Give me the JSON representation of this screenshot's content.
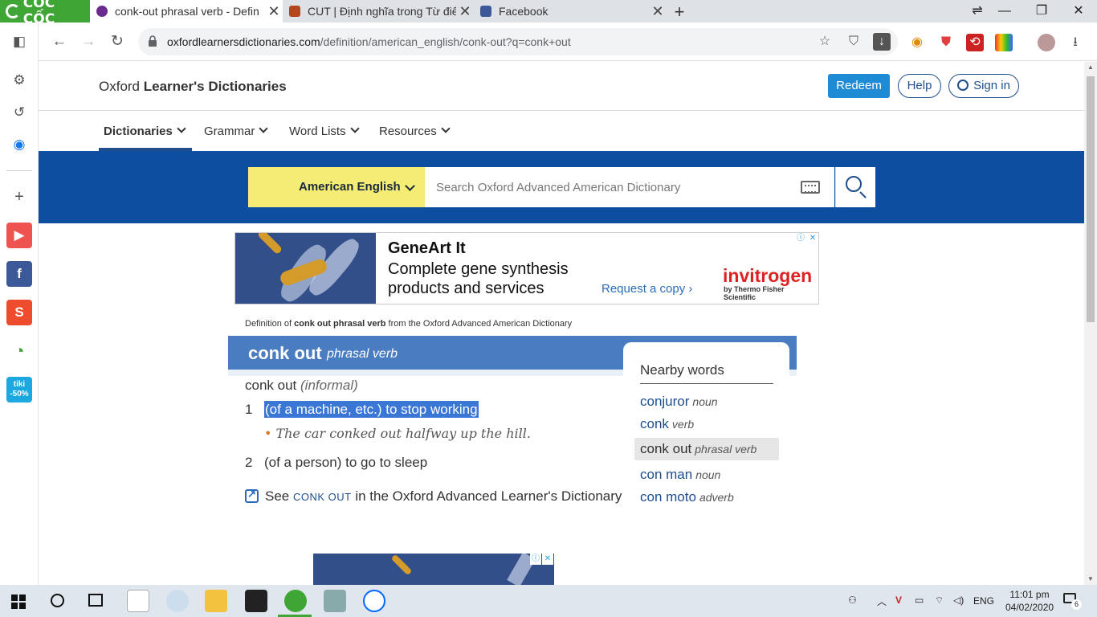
{
  "browser": {
    "brand": "CỐC CỐC",
    "tabs": [
      {
        "title": "conk-out phrasal verb - Defin",
        "active": true,
        "favicon_color": "#6b2c8f"
      },
      {
        "title": "CUT | Định nghĩa trong Từ điể",
        "active": false,
        "favicon_color": "#b5451b"
      },
      {
        "title": "Facebook",
        "active": false,
        "favicon_color": "#3b5998"
      }
    ],
    "url_host": "oxfordlearnersdictionaries.com",
    "url_path": "/definition/american_english/conk-out?q=conk+out"
  },
  "sidebar_icons": [
    "sidebar-toggle-icon",
    "settings-icon",
    "history-icon",
    "messenger-icon",
    "add-icon",
    "youtube-icon",
    "facebook-icon",
    "shopee-icon",
    "coccoc-icon",
    "tiki-icon"
  ],
  "sidebar": {
    "tiki_badge": "-50%"
  },
  "site": {
    "title_prefix": "Oxford ",
    "title_bold": "Learner's Dictionaries",
    "redeem": "Redeem",
    "help": "Help",
    "signin": "Sign in",
    "menu": [
      "Dictionaries",
      "Grammar",
      "Word Lists",
      "Resources"
    ],
    "language": "American English",
    "search_placeholder": "Search Oxford Advanced American Dictionary"
  },
  "ad": {
    "headline": "GeneArt It",
    "body": "Complete gene synthesis products and services",
    "cta": "Request a copy ›",
    "brand": "invitrogen",
    "brand_sub": "by Thermo Fisher Scientific"
  },
  "entry": {
    "source_prefix": "Definition of ",
    "source_bold": "conk out phrasal verb",
    "source_suffix": " from the Oxford Advanced American Dictionary",
    "headword": "conk out",
    "pos": "phrasal verb",
    "phrase": "conk out",
    "register": "(informal)",
    "senses": [
      {
        "num": "1",
        "def": "(of a machine, etc.) to stop working",
        "highlighted": true,
        "example": "The car conked out halfway up the hill."
      },
      {
        "num": "2",
        "def": "(of a person) to go to sleep",
        "highlighted": false
      }
    ],
    "see_prefix": "See ",
    "see_link": "CONK OUT",
    "see_suffix": " in the Oxford Advanced Learner's Dictionary"
  },
  "nearby": {
    "title": "Nearby words",
    "words": [
      {
        "word": "conjuror",
        "pos": "noun"
      },
      {
        "word": "conk",
        "pos": "verb"
      },
      {
        "word": "conk out",
        "pos": "phrasal verb",
        "current": true
      },
      {
        "word": "con man",
        "pos": "noun"
      },
      {
        "word": "con moto",
        "pos": "adverb"
      }
    ]
  },
  "taskbar": {
    "lang": "ENG",
    "time": "11:01 pm",
    "date": "04/02/2020",
    "notif_count": "6"
  }
}
